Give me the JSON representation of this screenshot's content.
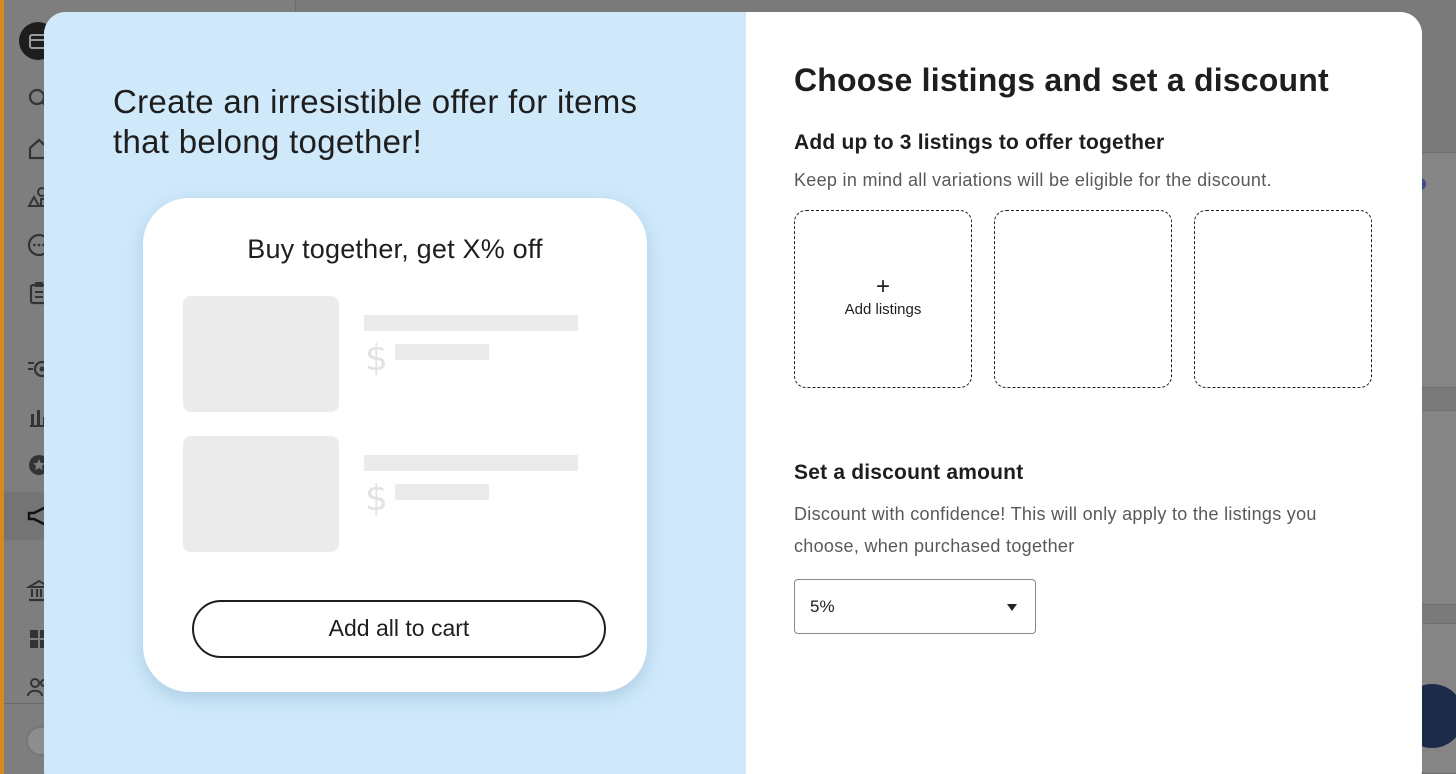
{
  "left_panel": {
    "headline": "Create an irresistible offer for items that belong together!",
    "preview": {
      "title": "Buy together, get X% off",
      "currency_symbol": "$",
      "cart_button_label": "Add all to cart"
    }
  },
  "right_panel": {
    "title": "Choose listings and set a discount",
    "listings_heading": "Add up to 3 listings to offer together",
    "listings_help": "Keep in mind all variations will be eligible for the discount.",
    "add_slot": {
      "icon": "plus-icon",
      "label": "Add listings"
    },
    "discount_heading": "Set a discount amount",
    "discount_help": "Discount with confidence! This will only apply to the listings you choose, when purchased together",
    "discount_select": {
      "value": "5%"
    }
  },
  "colors": {
    "left_panel_bg": "#cfe9fb",
    "overlay": "#7a7a7a",
    "sidebar_accent": "#d48a1e"
  }
}
